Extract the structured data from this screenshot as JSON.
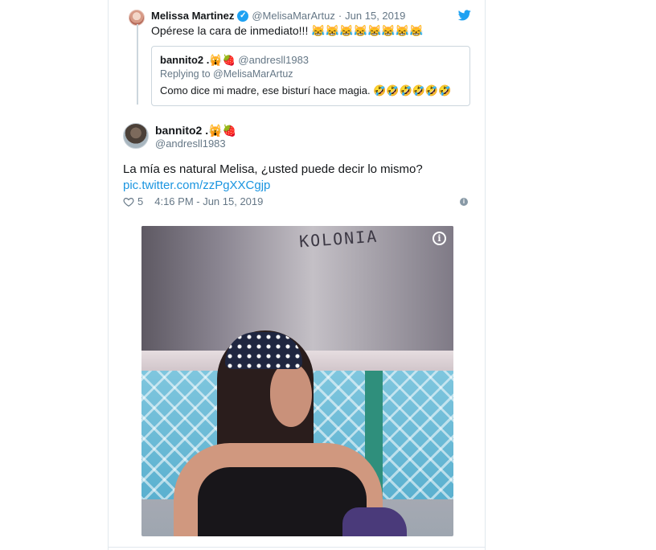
{
  "parent_tweet": {
    "name": "Melissa Martinez",
    "handle": "@MelisaMarArtuz",
    "date": "Jun 15, 2019",
    "text": "Opérese  la cara de inmediato!!! 😹😹😹😹😹😹😹😹",
    "quoted": {
      "name": "bannito2 .🙀🍓",
      "handle": "@andresll1983",
      "replying_to": "Replying to @MelisaMarArtuz",
      "text": "Como dice mi madre, ese bisturí hace magia. 🤣🤣🤣🤣🤣🤣"
    }
  },
  "main_tweet": {
    "name": "bannito2 .🙀🍓",
    "handle": "@andresll1983",
    "text": "La mía es natural Melisa, ¿usted puede decir lo mismo?",
    "link": "pic.twitter.com/zzPgXXCgjp",
    "likes": "5",
    "timestamp": "4:16 PM - Jun 15, 2019"
  },
  "photo": {
    "graffiti": "KOLONIA"
  },
  "icons": {
    "verified": "verified-badge-icon",
    "bird": "twitter-bird-icon",
    "heart": "heart-icon",
    "info": "info-icon"
  },
  "colors": {
    "link": "#1b95e0",
    "muted": "#657786",
    "brand": "#1da1f2"
  }
}
